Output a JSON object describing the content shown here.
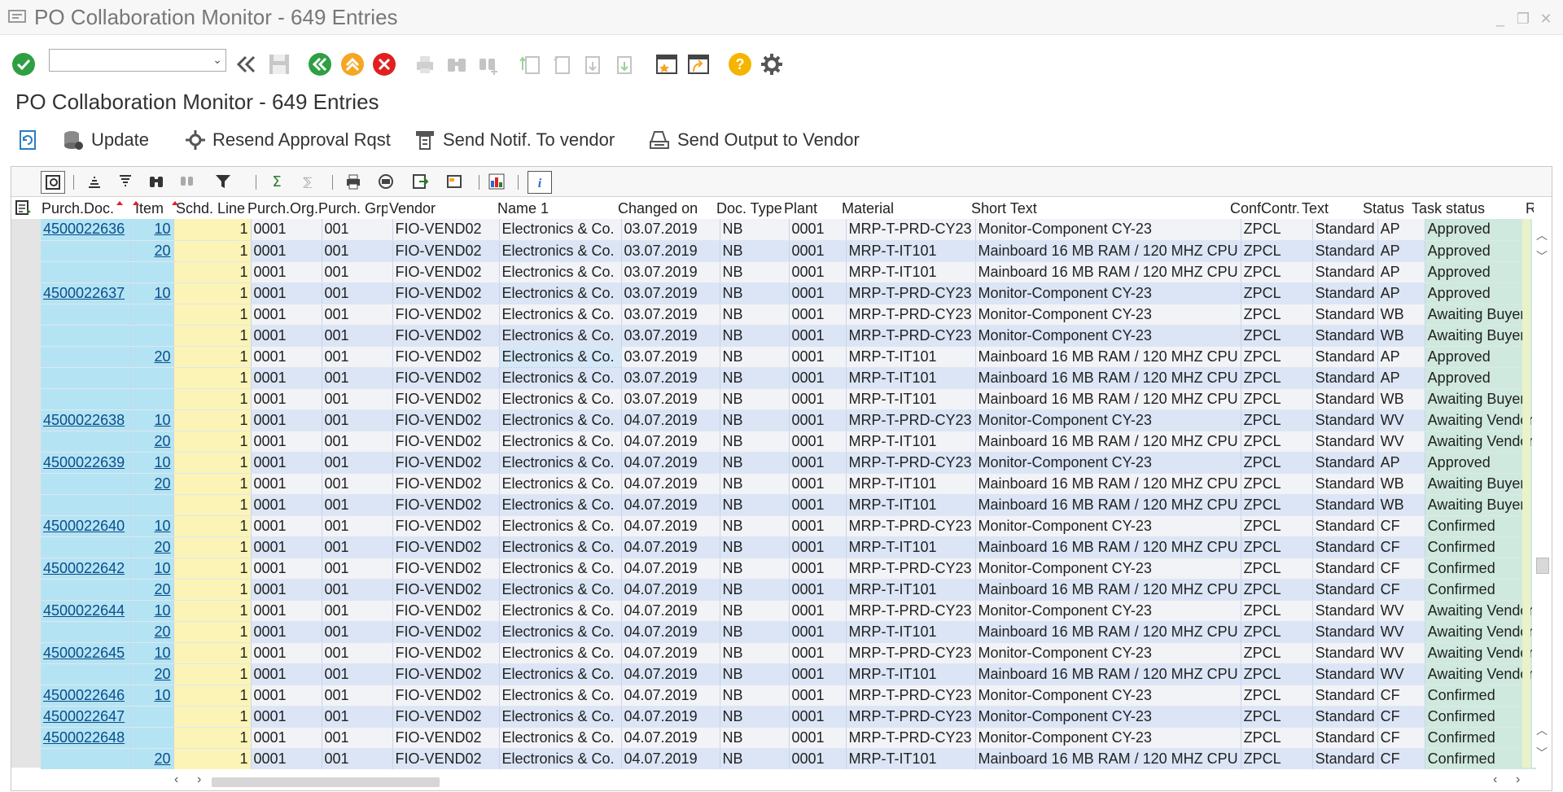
{
  "window": {
    "title": "PO Collaboration Monitor - 649 Entries"
  },
  "toolbar": {
    "command_field_value": ""
  },
  "subtitle": "PO Collaboration Monitor - 649 Entries",
  "app_toolbar": {
    "update": "Update",
    "resend": "Resend Approval Rqst",
    "notif": "Send Notif. To vendor",
    "output": "Send Output to Vendor"
  },
  "columns": [
    "Purch.Doc.",
    "Item",
    "Schd. Line",
    "Purch.Org.",
    "Purch. Grp",
    "Vendor",
    "Name 1",
    "Changed on",
    "Doc. Type",
    "Plant",
    "Material",
    "Short Text",
    "ConfContr.",
    "Text",
    "Status",
    "Task status",
    "R"
  ],
  "rows": [
    [
      "4500022636",
      "10",
      "1",
      "0001",
      "001",
      "FIO-VEND02",
      "Electronics & Co.",
      "03.07.2019",
      "NB",
      "0001",
      "MRP-T-PRD-CY23",
      "Monitor-Component CY-23",
      "ZPCL",
      "Standard",
      "AP",
      "Approved"
    ],
    [
      "",
      "20",
      "1",
      "0001",
      "001",
      "FIO-VEND02",
      "Electronics & Co.",
      "03.07.2019",
      "NB",
      "0001",
      "MRP-T-IT101",
      "Mainboard 16 MB RAM / 120 MHZ CPU",
      "ZPCL",
      "Standard",
      "AP",
      "Approved"
    ],
    [
      "",
      "",
      "1",
      "0001",
      "001",
      "FIO-VEND02",
      "Electronics & Co.",
      "03.07.2019",
      "NB",
      "0001",
      "MRP-T-IT101",
      "Mainboard 16 MB RAM / 120 MHZ CPU",
      "ZPCL",
      "Standard",
      "AP",
      "Approved"
    ],
    [
      "4500022637",
      "10",
      "1",
      "0001",
      "001",
      "FIO-VEND02",
      "Electronics & Co.",
      "03.07.2019",
      "NB",
      "0001",
      "MRP-T-PRD-CY23",
      "Monitor-Component CY-23",
      "ZPCL",
      "Standard",
      "AP",
      "Approved"
    ],
    [
      "",
      "",
      "1",
      "0001",
      "001",
      "FIO-VEND02",
      "Electronics & Co.",
      "03.07.2019",
      "NB",
      "0001",
      "MRP-T-PRD-CY23",
      "Monitor-Component CY-23",
      "ZPCL",
      "Standard",
      "WB",
      "Awaiting Buyer"
    ],
    [
      "",
      "",
      "1",
      "0001",
      "001",
      "FIO-VEND02",
      "Electronics & Co.",
      "03.07.2019",
      "NB",
      "0001",
      "MRP-T-PRD-CY23",
      "Monitor-Component CY-23",
      "ZPCL",
      "Standard",
      "WB",
      "Awaiting Buyer"
    ],
    [
      "",
      "20",
      "1",
      "0001",
      "001",
      "FIO-VEND02",
      "Electronics & Co.",
      "03.07.2019",
      "NB",
      "0001",
      "MRP-T-IT101",
      "Mainboard 16 MB RAM / 120 MHZ CPU",
      "ZPCL",
      "Standard",
      "AP",
      "Approved"
    ],
    [
      "",
      "",
      "1",
      "0001",
      "001",
      "FIO-VEND02",
      "Electronics & Co.",
      "03.07.2019",
      "NB",
      "0001",
      "MRP-T-IT101",
      "Mainboard 16 MB RAM / 120 MHZ CPU",
      "ZPCL",
      "Standard",
      "AP",
      "Approved"
    ],
    [
      "",
      "",
      "1",
      "0001",
      "001",
      "FIO-VEND02",
      "Electronics & Co.",
      "03.07.2019",
      "NB",
      "0001",
      "MRP-T-IT101",
      "Mainboard 16 MB RAM / 120 MHZ CPU",
      "ZPCL",
      "Standard",
      "WB",
      "Awaiting Buyer"
    ],
    [
      "4500022638",
      "10",
      "1",
      "0001",
      "001",
      "FIO-VEND02",
      "Electronics & Co.",
      "04.07.2019",
      "NB",
      "0001",
      "MRP-T-PRD-CY23",
      "Monitor-Component CY-23",
      "ZPCL",
      "Standard",
      "WV",
      "Awaiting Vendor"
    ],
    [
      "",
      "20",
      "1",
      "0001",
      "001",
      "FIO-VEND02",
      "Electronics & Co.",
      "04.07.2019",
      "NB",
      "0001",
      "MRP-T-IT101",
      "Mainboard 16 MB RAM / 120 MHZ CPU",
      "ZPCL",
      "Standard",
      "WV",
      "Awaiting Vendor"
    ],
    [
      "4500022639",
      "10",
      "1",
      "0001",
      "001",
      "FIO-VEND02",
      "Electronics & Co.",
      "04.07.2019",
      "NB",
      "0001",
      "MRP-T-PRD-CY23",
      "Monitor-Component CY-23",
      "ZPCL",
      "Standard",
      "AP",
      "Approved"
    ],
    [
      "",
      "20",
      "1",
      "0001",
      "001",
      "FIO-VEND02",
      "Electronics & Co.",
      "04.07.2019",
      "NB",
      "0001",
      "MRP-T-IT101",
      "Mainboard 16 MB RAM / 120 MHZ CPU",
      "ZPCL",
      "Standard",
      "WB",
      "Awaiting Buyer"
    ],
    [
      "",
      "",
      "1",
      "0001",
      "001",
      "FIO-VEND02",
      "Electronics & Co.",
      "04.07.2019",
      "NB",
      "0001",
      "MRP-T-IT101",
      "Mainboard 16 MB RAM / 120 MHZ CPU",
      "ZPCL",
      "Standard",
      "WB",
      "Awaiting Buyer"
    ],
    [
      "4500022640",
      "10",
      "1",
      "0001",
      "001",
      "FIO-VEND02",
      "Electronics & Co.",
      "04.07.2019",
      "NB",
      "0001",
      "MRP-T-PRD-CY23",
      "Monitor-Component CY-23",
      "ZPCL",
      "Standard",
      "CF",
      "Confirmed"
    ],
    [
      "",
      "20",
      "1",
      "0001",
      "001",
      "FIO-VEND02",
      "Electronics & Co.",
      "04.07.2019",
      "NB",
      "0001",
      "MRP-T-IT101",
      "Mainboard 16 MB RAM / 120 MHZ CPU",
      "ZPCL",
      "Standard",
      "CF",
      "Confirmed"
    ],
    [
      "4500022642",
      "10",
      "1",
      "0001",
      "001",
      "FIO-VEND02",
      "Electronics & Co.",
      "04.07.2019",
      "NB",
      "0001",
      "MRP-T-PRD-CY23",
      "Monitor-Component CY-23",
      "ZPCL",
      "Standard",
      "CF",
      "Confirmed"
    ],
    [
      "",
      "20",
      "1",
      "0001",
      "001",
      "FIO-VEND02",
      "Electronics & Co.",
      "04.07.2019",
      "NB",
      "0001",
      "MRP-T-IT101",
      "Mainboard 16 MB RAM / 120 MHZ CPU",
      "ZPCL",
      "Standard",
      "CF",
      "Confirmed"
    ],
    [
      "4500022644",
      "10",
      "1",
      "0001",
      "001",
      "FIO-VEND02",
      "Electronics & Co.",
      "04.07.2019",
      "NB",
      "0001",
      "MRP-T-PRD-CY23",
      "Monitor-Component CY-23",
      "ZPCL",
      "Standard",
      "WV",
      "Awaiting Vendor"
    ],
    [
      "",
      "20",
      "1",
      "0001",
      "001",
      "FIO-VEND02",
      "Electronics & Co.",
      "04.07.2019",
      "NB",
      "0001",
      "MRP-T-IT101",
      "Mainboard 16 MB RAM / 120 MHZ CPU",
      "ZPCL",
      "Standard",
      "WV",
      "Awaiting Vendor"
    ],
    [
      "4500022645",
      "10",
      "1",
      "0001",
      "001",
      "FIO-VEND02",
      "Electronics & Co.",
      "04.07.2019",
      "NB",
      "0001",
      "MRP-T-PRD-CY23",
      "Monitor-Component CY-23",
      "ZPCL",
      "Standard",
      "WV",
      "Awaiting Vendor"
    ],
    [
      "",
      "20",
      "1",
      "0001",
      "001",
      "FIO-VEND02",
      "Electronics & Co.",
      "04.07.2019",
      "NB",
      "0001",
      "MRP-T-IT101",
      "Mainboard 16 MB RAM / 120 MHZ CPU",
      "ZPCL",
      "Standard",
      "WV",
      "Awaiting Vendor"
    ],
    [
      "4500022646",
      "10",
      "1",
      "0001",
      "001",
      "FIO-VEND02",
      "Electronics & Co.",
      "04.07.2019",
      "NB",
      "0001",
      "MRP-T-PRD-CY23",
      "Monitor-Component CY-23",
      "ZPCL",
      "Standard",
      "CF",
      "Confirmed"
    ],
    [
      "4500022647",
      "",
      "1",
      "0001",
      "001",
      "FIO-VEND02",
      "Electronics & Co.",
      "04.07.2019",
      "NB",
      "0001",
      "MRP-T-PRD-CY23",
      "Monitor-Component CY-23",
      "ZPCL",
      "Standard",
      "CF",
      "Confirmed"
    ],
    [
      "4500022648",
      "",
      "1",
      "0001",
      "001",
      "FIO-VEND02",
      "Electronics & Co.",
      "04.07.2019",
      "NB",
      "0001",
      "MRP-T-PRD-CY23",
      "Monitor-Component CY-23",
      "ZPCL",
      "Standard",
      "CF",
      "Confirmed"
    ],
    [
      "",
      "20",
      "1",
      "0001",
      "001",
      "FIO-VEND02",
      "Electronics & Co.",
      "04.07.2019",
      "NB",
      "0001",
      "MRP-T-IT101",
      "Mainboard 16 MB RAM / 120 MHZ CPU",
      "ZPCL",
      "Standard",
      "CF",
      "Confirmed"
    ]
  ],
  "colors": {
    "key_cols": "#b4e4f3",
    "schd_col": "#fbf4b6",
    "task_col": "#cfe9de",
    "link": "#0a4d8c",
    "row_alt": "#dbe5f5"
  }
}
